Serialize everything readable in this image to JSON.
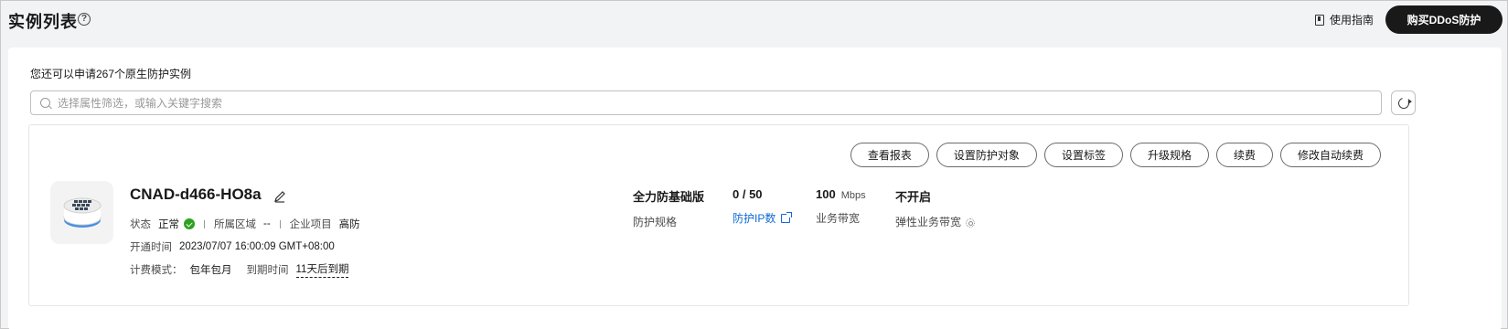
{
  "header": {
    "title": "实例列表",
    "help_icon": "question-circle-icon",
    "guide_label": "使用指南",
    "buy_label": "购买DDoS防护"
  },
  "main": {
    "quota_text": "您还可以申请267个原生防护实例",
    "search": {
      "placeholder": "选择属性筛选，或输入关键字搜索",
      "value": ""
    },
    "refresh_icon": "refresh-icon"
  },
  "instance": {
    "name": "CNAD-d466-HO8a",
    "actions": [
      "查看报表",
      "设置防护对象",
      "设置标签",
      "升级规格",
      "续费",
      "修改自动续费"
    ],
    "status_key": "状态",
    "status_val": "正常",
    "region_key": "所属区域",
    "region_val": "--",
    "project_key": "企业项目",
    "project_val": "高防",
    "open_time_key": "开通时间",
    "open_time_val": "2023/07/07 16:00:09 GMT+08:00",
    "billing_key": "计费模式：",
    "billing_val": "包年包月",
    "expire_key": "到期时间",
    "expire_val": "11天后到期",
    "specs": {
      "edition": "全力防基础版",
      "edition_key": "防护规格",
      "ip_count": "0 / 50",
      "ip_link": "防护IP数",
      "bandwidth": "100",
      "bandwidth_unit": "Mbps",
      "bandwidth_key": "业务带宽",
      "elastic": "不开启",
      "elastic_key": "弹性业务带宽"
    },
    "colors": {
      "status_ok": "#2ea121",
      "link": "#0f6ad6",
      "primary_button": "#191919"
    }
  }
}
